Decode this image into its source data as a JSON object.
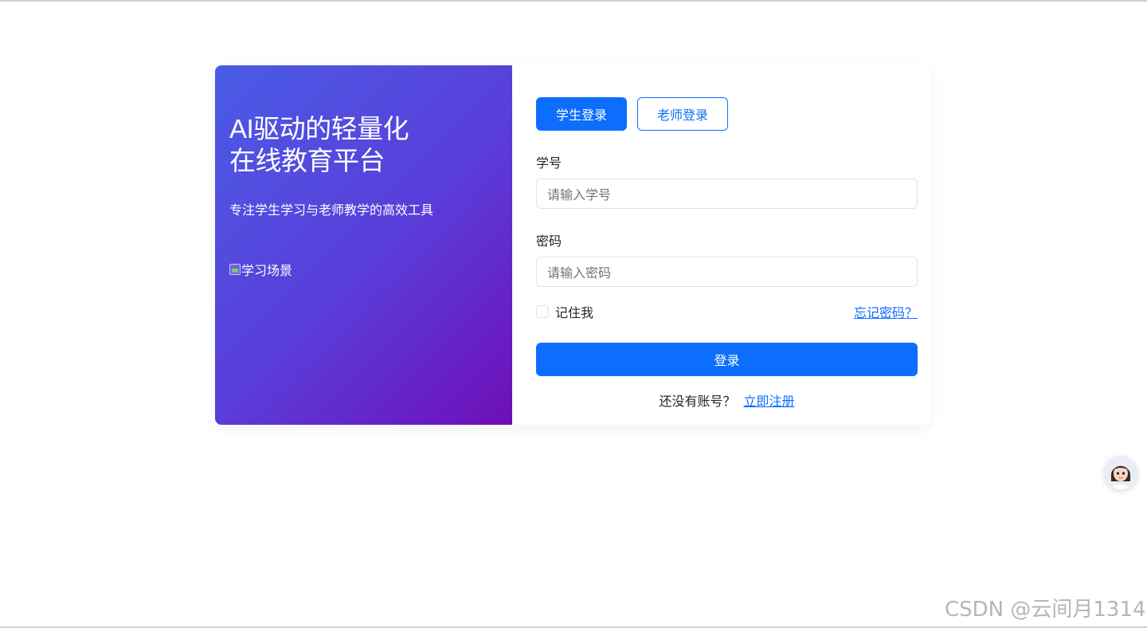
{
  "hero": {
    "headline_line1": "AI驱动的轻量化",
    "headline_line2": "在线教育平台",
    "tagline": "专注学生学习与老师教学的高效工具",
    "image_alt": "学习场景"
  },
  "tabs": [
    {
      "label": "学生登录",
      "active": true
    },
    {
      "label": "老师登录",
      "active": false
    }
  ],
  "form": {
    "student_id_label": "学号",
    "student_id_placeholder": "请输入学号",
    "password_label": "密码",
    "password_placeholder": "请输入密码",
    "remember_label": "记住我",
    "forgot_link": "忘记密码？",
    "submit_label": "登录",
    "no_account_text": "还没有账号？",
    "register_link": "立即注册"
  },
  "watermark": "CSDN @云间月1314",
  "colors": {
    "primary": "#0d6efd",
    "gradient_start": "#4a5ce6",
    "gradient_end": "#6f0eb8"
  }
}
